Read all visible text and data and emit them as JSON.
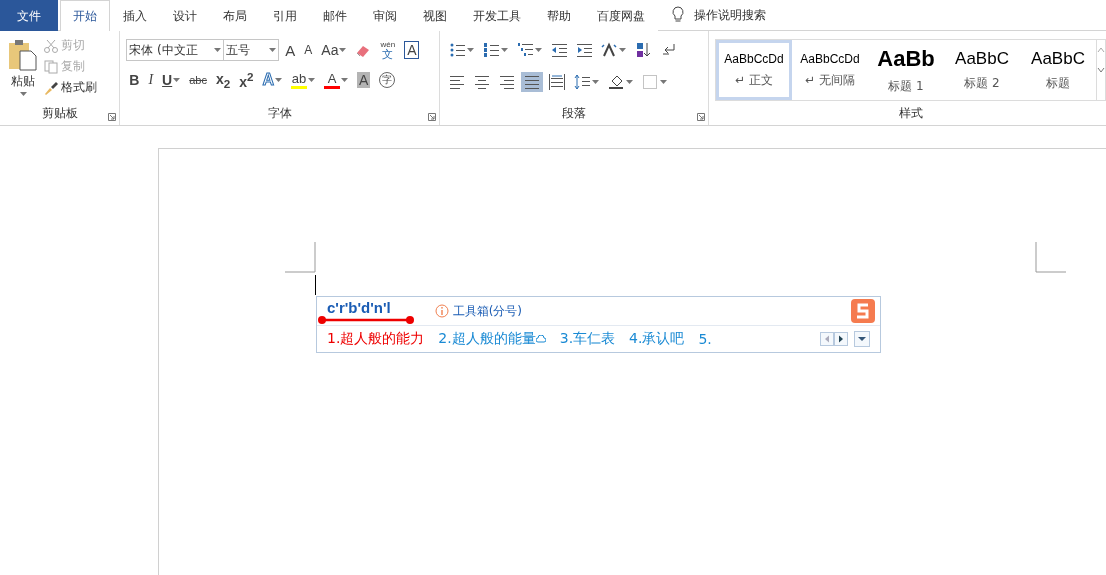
{
  "tabs": [
    {
      "label": "文件",
      "kind": "file",
      "selected": false
    },
    {
      "label": "开始",
      "kind": "tab",
      "selected": true
    },
    {
      "label": "插入",
      "kind": "tab",
      "selected": false
    },
    {
      "label": "设计",
      "kind": "tab",
      "selected": false
    },
    {
      "label": "布局",
      "kind": "tab",
      "selected": false
    },
    {
      "label": "引用",
      "kind": "tab",
      "selected": false
    },
    {
      "label": "邮件",
      "kind": "tab",
      "selected": false
    },
    {
      "label": "审阅",
      "kind": "tab",
      "selected": false
    },
    {
      "label": "视图",
      "kind": "tab",
      "selected": false
    },
    {
      "label": "开发工具",
      "kind": "tab",
      "selected": false
    },
    {
      "label": "帮助",
      "kind": "tab",
      "selected": false
    },
    {
      "label": "百度网盘",
      "kind": "tab",
      "selected": false
    }
  ],
  "search": {
    "text": "操作说明搜索"
  },
  "clipboard": {
    "paste": "粘贴",
    "label": "剪贴板",
    "items": [
      {
        "kind": "cut",
        "label": "剪切",
        "disabled": true
      },
      {
        "kind": "copy",
        "label": "复制",
        "disabled": true
      },
      {
        "kind": "painter",
        "label": "格式刷",
        "disabled": false
      }
    ]
  },
  "font": {
    "label": "字体",
    "font_name": "宋体 (中文正",
    "font_size": "五号",
    "row1": [
      {
        "kind": "grow",
        "label": "A"
      },
      {
        "kind": "shrink",
        "label": "A"
      },
      {
        "kind": "case",
        "label": "Aa",
        "dropdown": true
      },
      {
        "kind": "clear"
      },
      {
        "kind": "pinyin",
        "top": "wén",
        "label": "文"
      },
      {
        "kind": "border",
        "label": "A"
      }
    ],
    "row2": [
      {
        "kind": "bold",
        "label": "B"
      },
      {
        "kind": "italic",
        "label": "I"
      },
      {
        "kind": "underline",
        "label": "U",
        "dropdown": true
      },
      {
        "kind": "strike",
        "label": "abc"
      },
      {
        "kind": "sub",
        "label": "x$_{2}$"
      },
      {
        "kind": "sup",
        "label": "x$^{2}$"
      },
      {
        "kind": "effects",
        "label": "A",
        "dropdown": true
      },
      {
        "kind": "highlight",
        "label": "ab",
        "dropdown": true,
        "color": "#ffff00"
      },
      {
        "kind": "fontcolor",
        "label": "A",
        "dropdown": true,
        "color": "#ff0000"
      },
      {
        "kind": "shading",
        "label": "A"
      },
      {
        "kind": "enclose",
        "label": "字"
      }
    ]
  },
  "paragraph": {
    "label": "段落",
    "row1": [
      {
        "kind": "bullets",
        "dropdown": true,
        "selected": false
      },
      {
        "kind": "numbering",
        "dropdown": true,
        "selected": false
      },
      {
        "kind": "multilevel",
        "dropdown": true,
        "selected": false
      },
      {
        "kind": "outdent",
        "selected": false
      },
      {
        "kind": "indent",
        "selected": false
      },
      {
        "kind": "asian",
        "dropdown": true,
        "selected": false
      },
      {
        "kind": "sort",
        "selected": false
      },
      {
        "kind": "marks",
        "selected": false
      }
    ],
    "row2": [
      {
        "kind": "left",
        "selected": false
      },
      {
        "kind": "center",
        "selected": false
      },
      {
        "kind": "right",
        "selected": false
      },
      {
        "kind": "justify",
        "selected": true
      },
      {
        "kind": "distribute",
        "selected": false
      },
      {
        "kind": "spacing",
        "dropdown": true,
        "selected": false
      },
      {
        "kind": "fill",
        "dropdown": true,
        "selected": false
      },
      {
        "kind": "borders",
        "dropdown": true,
        "selected": false
      }
    ]
  },
  "styles": {
    "label": "样式",
    "items": [
      {
        "kind": "normal",
        "preview": "AaBbCcDd",
        "name": "↵ 正文",
        "selected": true
      },
      {
        "kind": "nospacing",
        "preview": "AaBbCcDd",
        "name": "↵ 无间隔",
        "selected": false
      },
      {
        "kind": "heading1",
        "preview": "AaBb",
        "name": "标题 1",
        "selected": false
      },
      {
        "kind": "heading2",
        "preview": "AaBbC",
        "name": "标题 2",
        "selected": false
      },
      {
        "kind": "title",
        "preview": "AaBbC",
        "name": "标题",
        "selected": false
      }
    ]
  },
  "ime": {
    "input": "c'r'b'd'n'l",
    "toolbox": "工具箱(分号)",
    "candidates": [
      {
        "text": "1.超人般的能力",
        "selected": true,
        "cloud": false
      },
      {
        "text": "2.超人般的能量",
        "selected": false,
        "cloud": true
      },
      {
        "text": "3.车仁表",
        "selected": false,
        "cloud": false
      },
      {
        "text": "4.承认吧",
        "selected": false,
        "cloud": false
      },
      {
        "text": "5.",
        "selected": false,
        "cloud": false
      }
    ]
  }
}
